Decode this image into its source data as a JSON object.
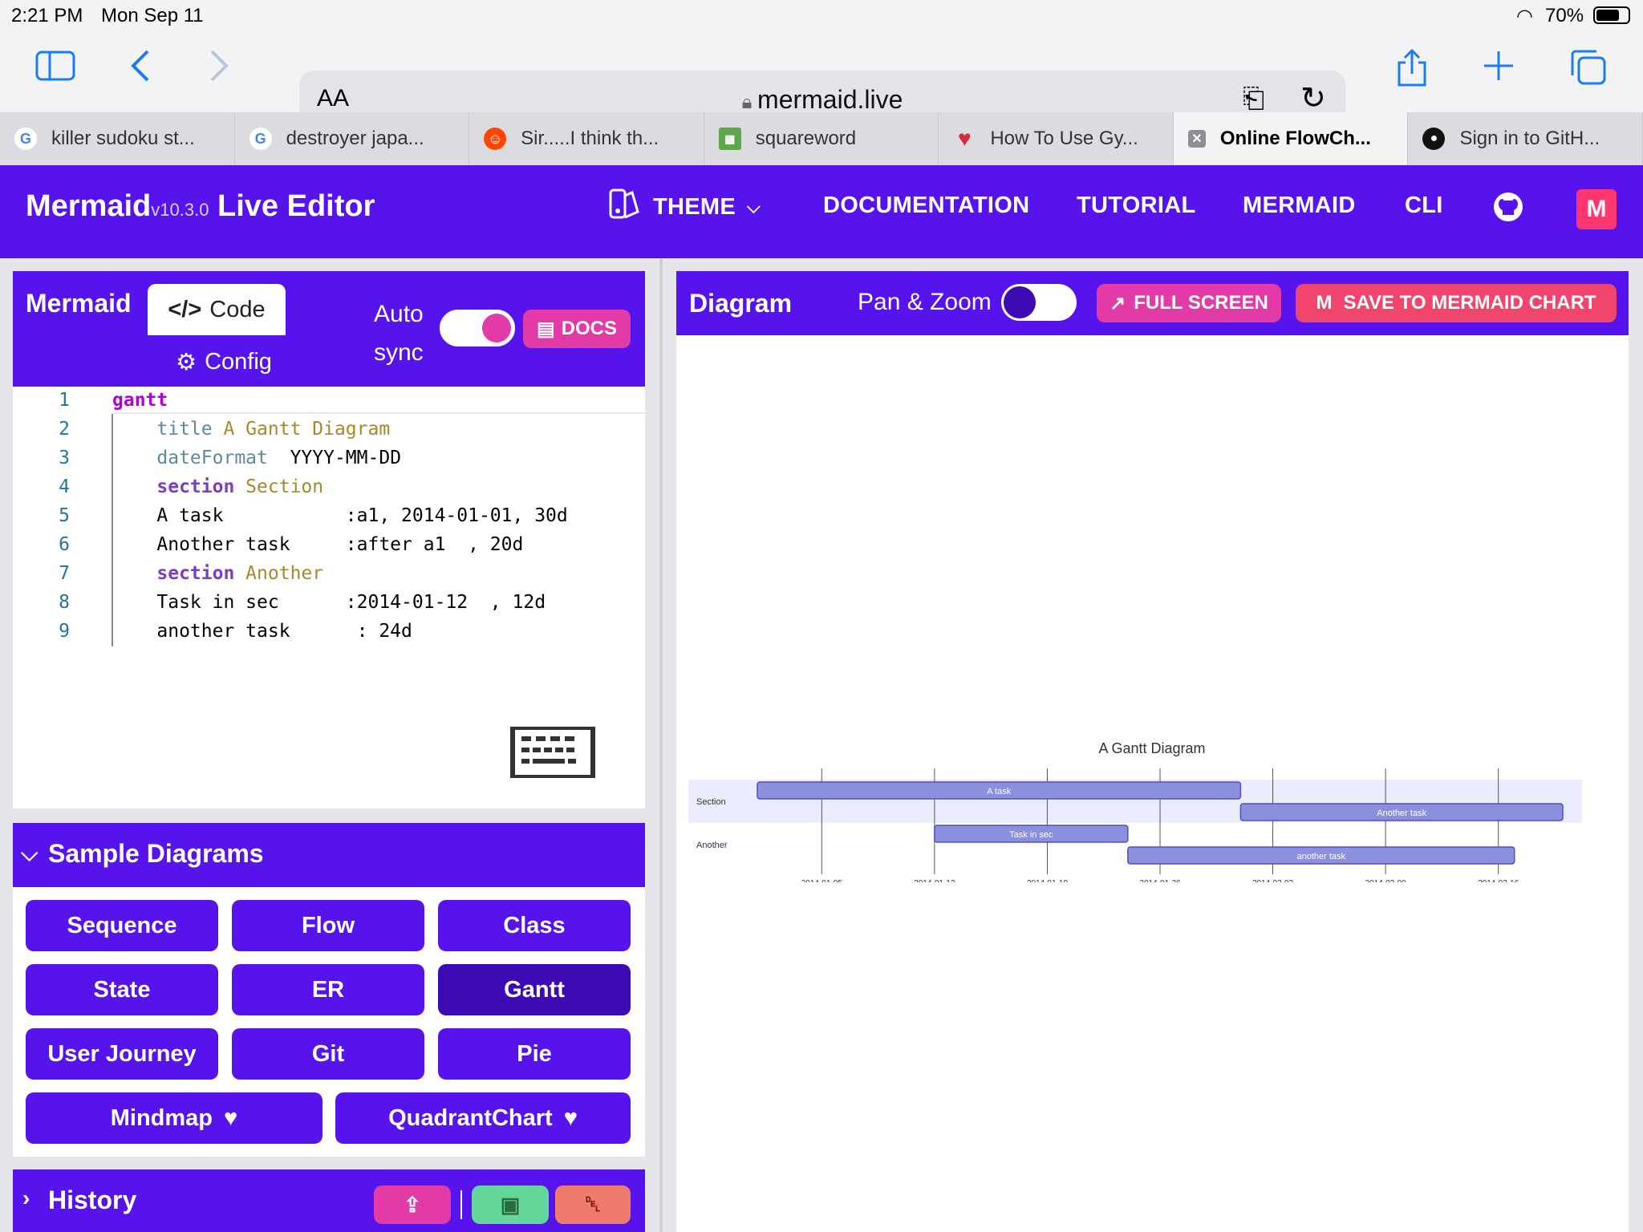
{
  "status_bar": {
    "time": "2:21 PM",
    "date": "Mon Sep 11",
    "battery": "70%"
  },
  "toolbar": {
    "aa_label": "AA",
    "url": "mermaid.live"
  },
  "tabs": [
    {
      "title": "killer sudoku st...",
      "icon": "google-icon"
    },
    {
      "title": "destroyer japa...",
      "icon": "google-icon"
    },
    {
      "title": "Sir.....I think th...",
      "icon": "reddit-icon"
    },
    {
      "title": "squareword",
      "icon": "grid-icon"
    },
    {
      "title": "How To Use Gy...",
      "icon": "heart-icon"
    },
    {
      "title": "Online FlowCh...",
      "icon": "close-icon",
      "active": true
    },
    {
      "title": "Sign in to GitH...",
      "icon": "github-icon"
    }
  ],
  "header": {
    "brand": "Mermaid",
    "version": "v10.3.0",
    "subtitle": "Live Editor",
    "nav": {
      "theme": "THEME",
      "documentation": "DOCUMENTATION",
      "tutorial": "TUTORIAL",
      "mermaid": "MERMAID",
      "cli": "CLI"
    }
  },
  "editor_panel": {
    "title": "Mermaid",
    "code_tab": "Code",
    "config_tab": "Config",
    "auto_sync_line1": "Auto",
    "auto_sync_line2": "sync",
    "auto_sync_on": true,
    "docs_label": "DOCS",
    "code_lines": [
      {
        "n": "1",
        "parts": [
          {
            "t": "gantt",
            "c": "kw"
          }
        ]
      },
      {
        "n": "2",
        "parts": [
          {
            "t": "    "
          },
          {
            "t": "title",
            "c": "prop"
          },
          {
            "t": " A Gantt Diagram",
            "c": "str"
          }
        ]
      },
      {
        "n": "3",
        "parts": [
          {
            "t": "    "
          },
          {
            "t": "dateFormat",
            "c": "prop"
          },
          {
            "t": "  YYYY-MM-DD"
          }
        ]
      },
      {
        "n": "4",
        "parts": [
          {
            "t": "    "
          },
          {
            "t": "section",
            "c": "kw2"
          },
          {
            "t": " Section",
            "c": "str"
          }
        ]
      },
      {
        "n": "5",
        "parts": [
          {
            "t": "    A task           :a1, 2014-01-01, 30d"
          }
        ]
      },
      {
        "n": "6",
        "parts": [
          {
            "t": "    Another task     :after a1  , 20d"
          }
        ]
      },
      {
        "n": "7",
        "parts": [
          {
            "t": "    "
          },
          {
            "t": "section",
            "c": "kw2"
          },
          {
            "t": " Another",
            "c": "str"
          }
        ]
      },
      {
        "n": "8",
        "parts": [
          {
            "t": "    Task in sec      :2014-01-12  , 12d"
          }
        ]
      },
      {
        "n": "9",
        "parts": [
          {
            "t": "    another task      : 24d"
          }
        ]
      }
    ]
  },
  "samples": {
    "title": "Sample Diagrams",
    "buttons": [
      "Sequence",
      "Flow",
      "Class",
      "State",
      "ER",
      "Gantt",
      "User Journey",
      "Git",
      "Pie"
    ],
    "selected": "Gantt",
    "new_buttons": [
      "Mindmap",
      "QuadrantChart"
    ]
  },
  "history": {
    "title": "History"
  },
  "diagram_panel": {
    "title": "Diagram",
    "pan_zoom_label": "Pan & Zoom",
    "pan_zoom_on": false,
    "fullscreen_label": "FULL SCREEN",
    "save_label": "SAVE TO MERMAID CHART"
  },
  "chart_data": {
    "type": "gantt",
    "title": "A Gantt Diagram",
    "x_range": [
      "2014-01-01",
      "2014-02-20"
    ],
    "ticks": [
      "2014-01-05",
      "2014-01-12",
      "2014-01-19",
      "2014-01-26",
      "2014-02-02",
      "2014-02-09",
      "2014-02-16"
    ],
    "sections": [
      {
        "name": "Section",
        "tasks": [
          {
            "name": "A task",
            "start": "2014-01-01",
            "end": "2014-01-31"
          },
          {
            "name": "Another task",
            "start": "2014-01-31",
            "end": "2014-02-20"
          }
        ]
      },
      {
        "name": "Another",
        "tasks": [
          {
            "name": "Task in sec",
            "start": "2014-01-12",
            "end": "2014-01-24"
          },
          {
            "name": "another task",
            "start": "2014-01-24",
            "end": "2014-02-17"
          }
        ]
      }
    ],
    "colors": {
      "bar": "#8a90dd",
      "bar_stroke": "#534fbc",
      "section_band": "#ececff",
      "grid": "#555555"
    }
  }
}
